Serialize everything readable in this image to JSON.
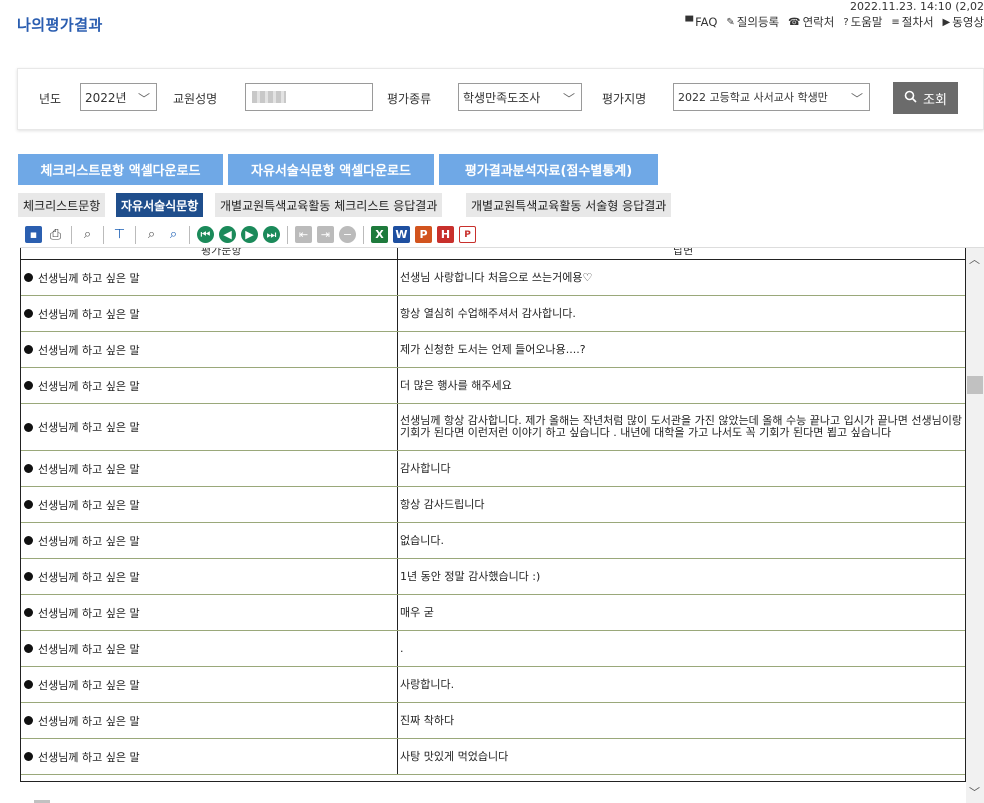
{
  "page": {
    "title": "나의평가결과",
    "timestamp": "2022.11.23. 14:10 (2,02"
  },
  "top_links": [
    {
      "icon": "faq-icon",
      "glyph": "▀",
      "label": "FAQ"
    },
    {
      "icon": "pencil-icon",
      "glyph": "✎",
      "label": "질의등록"
    },
    {
      "icon": "phone-icon",
      "glyph": "☎",
      "label": "연락처"
    },
    {
      "icon": "help-icon",
      "glyph": "?",
      "label": "도움말"
    },
    {
      "icon": "list-icon",
      "glyph": "≡",
      "label": "절차서"
    },
    {
      "icon": "play-icon",
      "glyph": "▶",
      "label": "동영상"
    }
  ],
  "filters": {
    "year_label": "년도",
    "year_value": "2022년",
    "teacher_label": "교원성명",
    "type_label": "평가종류",
    "type_value": "학생만족도조사",
    "index_label": "평가지명",
    "index_value": "2022 고등학교 사서교사 학생만",
    "search_label": "조회"
  },
  "download_buttons": [
    "체크리스트문항 액셀다운로드",
    "자유서술식문항 액셀다운로드",
    "평가결과분석자료(점수별통계)"
  ],
  "tabs": [
    {
      "label": "체크리스트문항",
      "active": false
    },
    {
      "label": "자유서술식문항",
      "active": true
    },
    {
      "label": "개별교원특색교육활동 체크리스트 응답결과",
      "active": false
    },
    {
      "label": "개별교원특색교육활동 서술형 응답결과",
      "active": false
    }
  ],
  "toolbar": [
    "save-icon",
    "print-icon",
    "|",
    "zoom-icon",
    "|",
    "tree-icon",
    "|",
    "find-icon",
    "find-next-icon",
    "|",
    "first-page-icon",
    "prev-page-icon",
    "next-page-icon",
    "last-page-icon",
    "|",
    "export-icon",
    "import-icon",
    "stop-icon",
    "|",
    "excel-icon",
    "word-icon",
    "ppt-icon",
    "hwp-icon",
    "pdf-icon"
  ],
  "report": {
    "header": {
      "col1": "평가문항",
      "col2": "답변"
    },
    "rows": [
      {
        "q": "선생님께 하고 싶은 말",
        "a": "선생님 사랑합니다 처음으로 쓰는거에용♡"
      },
      {
        "q": "선생님께 하고 싶은 말",
        "a": "항상 열심히 수업해주셔서 감사합니다."
      },
      {
        "q": "선생님께 하고 싶은 말",
        "a": "제가 신청한 도서는 언제 들어오나용....?"
      },
      {
        "q": "선생님께 하고 싶은 말",
        "a": "더 많은 행사를 해주세요"
      },
      {
        "q": "선생님께 하고 싶은 말",
        "a": "선생님께 항상 감사합니다. 제가 올해는 작년처럼 많이 도서관을 가진 않았는데 올해 수능 끝나고 입시가 끝나면 선생님이랑 기회가 된다면 이런저런 이야기 하고 싶습니다 . 내년에 대학을 가고 나서도 꼭 기회가 된다면 뵙고 싶습니다"
      },
      {
        "q": "선생님께 하고 싶은 말",
        "a": "감사합니다"
      },
      {
        "q": "선생님께 하고 싶은 말",
        "a": "항상 감사드립니다"
      },
      {
        "q": "선생님께 하고 싶은 말",
        "a": "없습니다."
      },
      {
        "q": "선생님께 하고 싶은 말",
        "a": "1년 동안 정말 감사했습니다 :)"
      },
      {
        "q": "선생님께 하고 싶은 말",
        "a": "매우 굳"
      },
      {
        "q": "선생님께 하고 싶은 말",
        "a": "."
      },
      {
        "q": "선생님께 하고 싶은 말",
        "a": "사랑합니다."
      },
      {
        "q": "선생님께 하고 싶은 말",
        "a": "진짜 착하다"
      },
      {
        "q": "선생님께 하고 싶은 말",
        "a": "사탕 맛있게 먹었습니다"
      }
    ]
  },
  "colors": {
    "title": "#2a5db0",
    "download_button": "#6fa8e6",
    "active_tab": "#1f4e8c",
    "search_button": "#6b6b6b"
  }
}
